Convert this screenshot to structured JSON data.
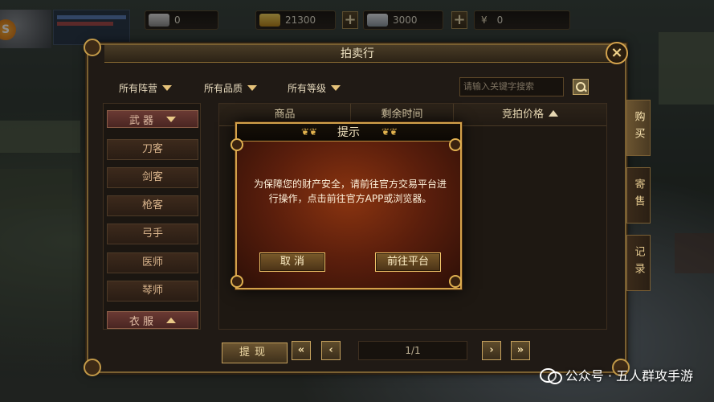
{
  "topbar": {
    "avatar_badge": "S",
    "ingot_value": "0",
    "gold_value": "21300",
    "silver_value": "3000",
    "yuan_symbol": "¥",
    "yuan_value": "0",
    "plus": "+"
  },
  "panel": {
    "title": "拍卖行",
    "close": "×"
  },
  "filters": {
    "camp": "所有阵营",
    "quality": "所有品质",
    "level": "所有等级",
    "search_placeholder": "请输入关键字搜索"
  },
  "categories": {
    "weapon_head": "武 器",
    "items": [
      "刀客",
      "剑客",
      "枪客",
      "弓手",
      "医师",
      "琴师"
    ],
    "clothing_head": "衣 服"
  },
  "table": {
    "headers": [
      "商品",
      "剩余时间",
      "竞拍价格"
    ]
  },
  "side_tabs": [
    "购买",
    "寄售",
    "记录"
  ],
  "bottom": {
    "withdraw": "提现",
    "first": "«",
    "prev": "‹",
    "page": "1/1",
    "next": "›",
    "last": "»"
  },
  "dialog": {
    "title": "提示",
    "message": "为保障您的财产安全，请前往官方交易平台进行操作，点击前往官方APP或浏览器。",
    "cancel": "取 消",
    "goto": "前往平台"
  },
  "watermark": {
    "text": "公众号 · 五人群攻手游"
  },
  "colors": {
    "gold_border": "#d3a14a",
    "dialog_red": "#8a3410",
    "panel_bg": "#201a15"
  }
}
